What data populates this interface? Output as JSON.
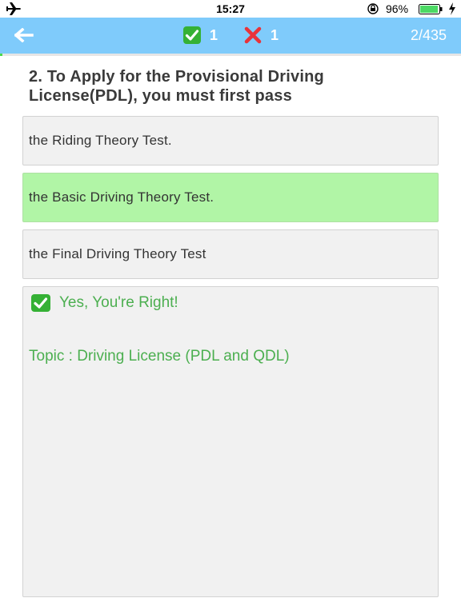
{
  "status_bar": {
    "time": "15:27",
    "battery_percent": "96%",
    "battery_level": 0.96
  },
  "nav": {
    "correct_count": "1",
    "wrong_count": "1",
    "progress_text": "2/435",
    "progress_fraction": 0.0046
  },
  "question": {
    "text": "2. To Apply for the Provisional Driving License(PDL), you must first pass"
  },
  "options": [
    {
      "label": "the Riding Theory Test.",
      "selected": false
    },
    {
      "label": "the Basic Driving Theory Test.",
      "selected": true
    },
    {
      "label": "the Final Driving Theory Test",
      "selected": false
    }
  ],
  "explanation": {
    "result_text": "Yes, You're Right!",
    "topic_text": "Topic : Driving License (PDL and QDL)"
  },
  "icons": {
    "plane": "airplane-icon",
    "lock": "rotation-lock-icon",
    "battery": "battery-icon",
    "bolt": "charging-bolt-icon",
    "back": "back-arrow-icon",
    "check": "check-mark-icon",
    "cross": "cross-mark-icon"
  },
  "colors": {
    "nav_bg": "#7fcbfb",
    "selected_option": "#b1f5a6",
    "success_text": "#4caf50",
    "check_box": "#35b135",
    "cross": "#e8333a"
  }
}
